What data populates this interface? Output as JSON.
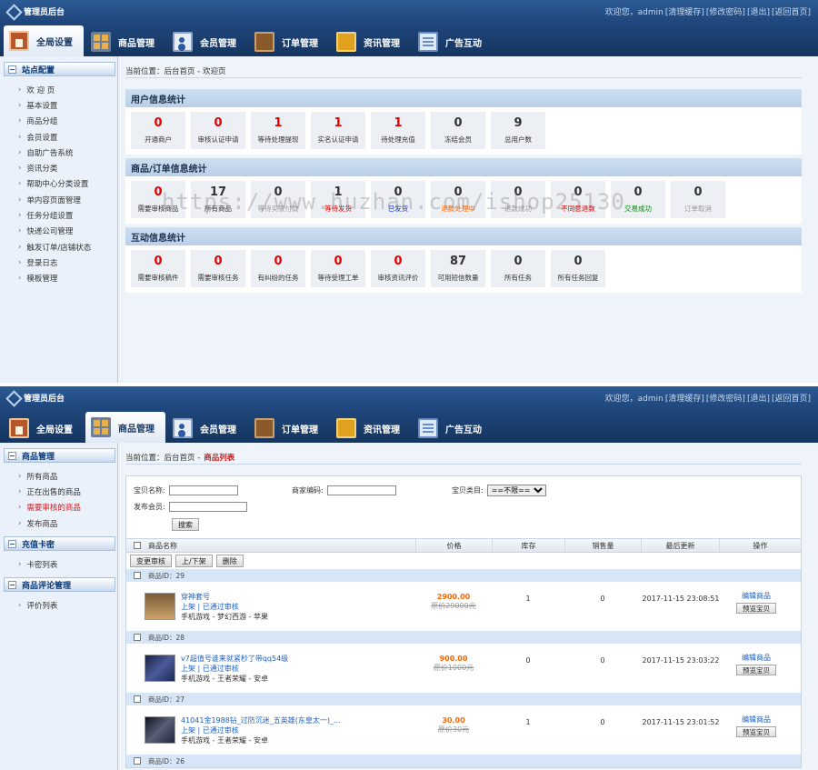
{
  "common": {
    "app_title": "管理员后台",
    "top_links": [
      "欢迎您，admin",
      "[清理缓存]",
      "[修改密码]",
      "[退出]",
      "[返回首页]"
    ],
    "tabs": [
      "全局设置",
      "商品管理",
      "会员管理",
      "订单管理",
      "资讯管理",
      "广告互动"
    ]
  },
  "screen1": {
    "sidebar_title": "站点配置",
    "sidebar_items": [
      "欢 迎 页",
      "基本设置",
      "商品分组",
      "会员设置",
      "自助广告系统",
      "资讯分类",
      "帮助中心分类设置",
      "单内容页面管理",
      "任务分组设置",
      "快递公司管理",
      "触发订单/店铺状态",
      "登录日志",
      "模板管理"
    ],
    "crumb": "当前位置：后台首页 - 欢迎页",
    "watermark": "https://www.huzhan.com/ishop25130",
    "sections": [
      {
        "title": "用户信息统计",
        "stats": [
          {
            "n": "0",
            "l": "开通商户",
            "ncls": "red",
            "lcls": ""
          },
          {
            "n": "0",
            "l": "审核认证申请",
            "ncls": "red",
            "lcls": ""
          },
          {
            "n": "1",
            "l": "等待处理提现",
            "ncls": "red",
            "lcls": ""
          },
          {
            "n": "1",
            "l": "实名认证申请",
            "ncls": "red",
            "lcls": ""
          },
          {
            "n": "1",
            "l": "待处理充值",
            "ncls": "red",
            "lcls": ""
          },
          {
            "n": "0",
            "l": "冻结会员",
            "ncls": "",
            "lcls": ""
          },
          {
            "n": "9",
            "l": "总用户数",
            "ncls": "",
            "lcls": ""
          }
        ]
      },
      {
        "title": "商品/订单信息统计",
        "stats": [
          {
            "n": "0",
            "l": "需要审核商品",
            "ncls": "red",
            "lcls": ""
          },
          {
            "n": "17",
            "l": "所有商品",
            "ncls": "",
            "lcls": ""
          },
          {
            "n": "0",
            "l": "等待买家付款",
            "ncls": "",
            "lcls": "grey"
          },
          {
            "n": "1",
            "l": "等待发货",
            "ncls": "",
            "lcls": "red"
          },
          {
            "n": "0",
            "l": "已发货",
            "ncls": "",
            "lcls": "blue"
          },
          {
            "n": "0",
            "l": "退款处理中",
            "ncls": "",
            "lcls": "orange"
          },
          {
            "n": "0",
            "l": "退款成功",
            "ncls": "",
            "lcls": "grey"
          },
          {
            "n": "0",
            "l": "不同意退款",
            "ncls": "",
            "lcls": "red"
          },
          {
            "n": "0",
            "l": "交易成功",
            "ncls": "",
            "lcls": "green"
          },
          {
            "n": "0",
            "l": "订单取消",
            "ncls": "",
            "lcls": "grey"
          }
        ]
      },
      {
        "title": "互动信息统计",
        "stats": [
          {
            "n": "0",
            "l": "需要审核稿件",
            "ncls": "red",
            "lcls": ""
          },
          {
            "n": "0",
            "l": "需要审核任务",
            "ncls": "red",
            "lcls": ""
          },
          {
            "n": "0",
            "l": "有纠纷的任务",
            "ncls": "red",
            "lcls": ""
          },
          {
            "n": "0",
            "l": "等待受理工单",
            "ncls": "red",
            "lcls": ""
          },
          {
            "n": "0",
            "l": "审核资讯评价",
            "ncls": "red",
            "lcls": ""
          },
          {
            "n": "87",
            "l": "可用短信数量",
            "ncls": "",
            "lcls": ""
          },
          {
            "n": "0",
            "l": "所有任务",
            "ncls": "",
            "lcls": ""
          },
          {
            "n": "0",
            "l": "所有任务回复",
            "ncls": "",
            "lcls": ""
          }
        ]
      }
    ]
  },
  "screen2": {
    "sidebar_groups": [
      {
        "title": "商品管理",
        "items": [
          "所有商品",
          "正在出售的商品",
          "需要审核的商品",
          "发布商品"
        ],
        "active": 2
      },
      {
        "title": "充值卡密",
        "items": [
          "卡密列表"
        ],
        "active": -1
      },
      {
        "title": "商品评论管理",
        "items": [
          "评价列表"
        ],
        "active": -1
      }
    ],
    "crumb_prefix": "当前位置：后台首页 -",
    "crumb_current": "商品列表",
    "filter": {
      "name_label": "宝贝名称:",
      "code_label": "商家编码:",
      "type_label": "宝贝类目:",
      "type_value": "==不限==",
      "member_label": "发布会员:",
      "search_btn": "搜索"
    },
    "columns": [
      "商品名称",
      "价格",
      "库存",
      "销售量",
      "最后更新",
      "操作"
    ],
    "bulk_buttons": [
      "变更审核",
      "上/下架",
      "删除"
    ],
    "rows": [
      {
        "id": "商品ID：29",
        "name": "穿神套号",
        "status": "上架 | 已通过审核",
        "cat": "手机游戏 - 梦幻西游 - 苹果",
        "price": "2900.00",
        "old": "原价29000元",
        "stock": "1",
        "sales": "0",
        "updated": "2017-11-15 23:08:51",
        "edit": "编辑商品",
        "preview": "预览宝贝",
        "thumb": "a"
      },
      {
        "id": "商品ID：28",
        "name": "v7超值号谁来就紧秒了带qq54级",
        "status": "上架 | 已通过审核",
        "cat": "手机游戏 - 王者荣耀 - 安卓",
        "price": "900.00",
        "old": "原价1000元",
        "stock": "0",
        "sales": "0",
        "updated": "2017-11-15 23:03:22",
        "edit": "编辑商品",
        "preview": "预览宝贝",
        "thumb": "b"
      },
      {
        "id": "商品ID：27",
        "name": "41041金1988钻_过防沉迷_五英雄(东皇太一)_...",
        "status": "上架 | 已通过审核",
        "cat": "手机游戏 - 王者荣耀 - 安卓",
        "price": "30.00",
        "old": "原价30元",
        "stock": "1",
        "sales": "0",
        "updated": "2017-11-15 23:01:52",
        "edit": "编辑商品",
        "preview": "预览宝贝",
        "thumb": "c"
      }
    ],
    "last_id": "商品ID：26"
  }
}
